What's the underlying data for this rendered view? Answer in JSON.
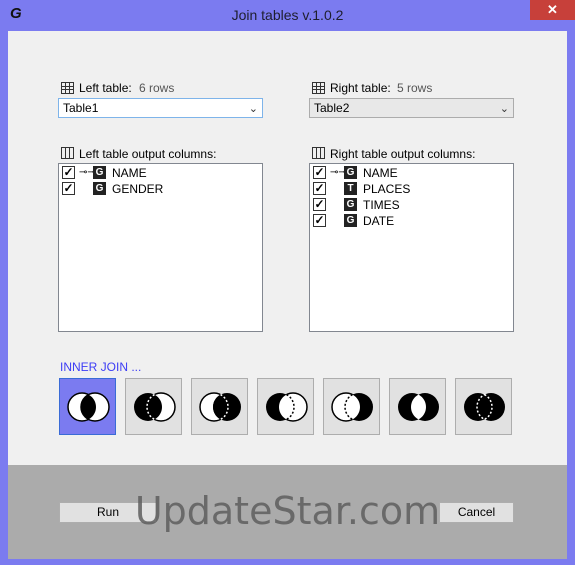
{
  "window": {
    "app_icon": "G",
    "title": "Join tables v.1.0.2",
    "close_glyph": "✕"
  },
  "left": {
    "table_label": "Left table:",
    "rows": "6 rows",
    "selected_table": "Table1",
    "columns_label": "Left table output columns:",
    "columns": [
      {
        "checked": true,
        "key": true,
        "type": "G",
        "name": "NAME"
      },
      {
        "checked": true,
        "key": false,
        "type": "G",
        "name": "GENDER"
      }
    ]
  },
  "right": {
    "table_label": "Right table:",
    "rows": "5 rows",
    "selected_table": "Table2",
    "columns_label": "Right table output columns:",
    "columns": [
      {
        "checked": true,
        "key": true,
        "type": "G",
        "name": "NAME"
      },
      {
        "checked": true,
        "key": false,
        "type": "T",
        "name": "PLACES"
      },
      {
        "checked": true,
        "key": false,
        "type": "G",
        "name": "TIMES"
      },
      {
        "checked": true,
        "key": false,
        "type": "G",
        "name": "DATE"
      }
    ]
  },
  "join": {
    "title": "INNER JOIN ...",
    "selected_index": 0,
    "types": [
      "inner-join-icon",
      "left-join-icon",
      "right-join-icon",
      "left-only-icon",
      "right-only-icon",
      "full-outer-join-icon",
      "full-join-icon"
    ]
  },
  "buttons": {
    "run": "Run",
    "cancel": "Cancel"
  },
  "watermark": "UpdateStar.com",
  "colors": {
    "frame": "#7b7bf0",
    "client": "#f0f0f0",
    "bottom_band": "#ababab",
    "join_title": "#3d3df5",
    "close": "#c7403a"
  }
}
